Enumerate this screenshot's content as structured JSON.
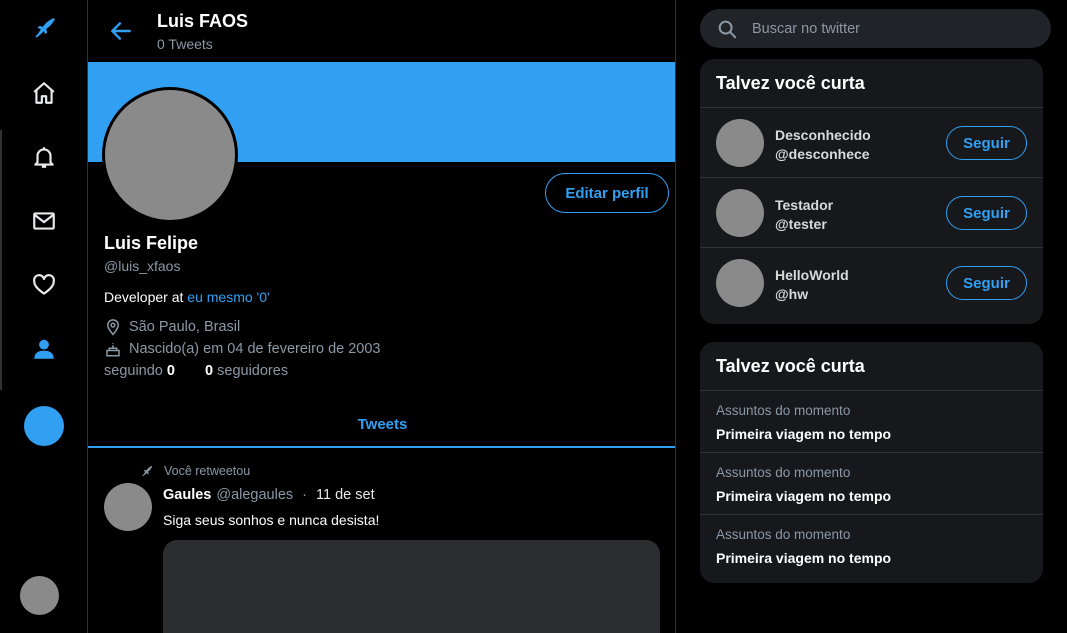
{
  "colors": {
    "accent": "#31a0f2",
    "background": "#000000",
    "card": "#16181c",
    "muted": "#8b98a5"
  },
  "rail": {
    "items": [
      {
        "icon": "bird-logo-icon"
      },
      {
        "icon": "home-icon"
      },
      {
        "icon": "bell-icon"
      },
      {
        "icon": "mail-icon"
      },
      {
        "icon": "heart-icon"
      },
      {
        "icon": "user-icon"
      }
    ]
  },
  "header": {
    "title": "Luis FAOS",
    "subtitle": "0 Tweets"
  },
  "profile": {
    "edit_label": "Editar perfil",
    "name": "Luis Felipe",
    "handle": "@luis_xfaos",
    "bio_prefix": "Developer at ",
    "bio_link": "eu mesmo '0'",
    "location": "São Paulo, Brasil",
    "birth": "Nascido(a) em 04 de fevereiro de 2003",
    "following_label": "seguindo",
    "following_count": "0",
    "followers_count": "0",
    "followers_label": "seguidores"
  },
  "tabs": {
    "tweets": "Tweets"
  },
  "tweet": {
    "retweet_label": "Você retweetou",
    "author": "Gaules",
    "handle": "@alegaules",
    "dot": "·",
    "date": "11 de set",
    "text": "Siga seus sonhos e nunca desista!"
  },
  "search": {
    "placeholder": "Buscar no twitter"
  },
  "who_to_follow": {
    "title": "Talvez você curta",
    "follow_label": "Seguir",
    "users": [
      {
        "name": "Desconhecido",
        "handle": "@desconhece"
      },
      {
        "name": "Testador",
        "handle": "@tester"
      },
      {
        "name": "HelloWorld",
        "handle": "@hw"
      }
    ]
  },
  "trends": {
    "title": "Talvez você curta",
    "items": [
      {
        "category": "Assuntos do momento",
        "name": "Primeira viagem no tempo"
      },
      {
        "category": "Assuntos do momento",
        "name": "Primeira viagem no tempo"
      },
      {
        "category": "Assuntos do momento",
        "name": "Primeira viagem no tempo"
      }
    ]
  }
}
